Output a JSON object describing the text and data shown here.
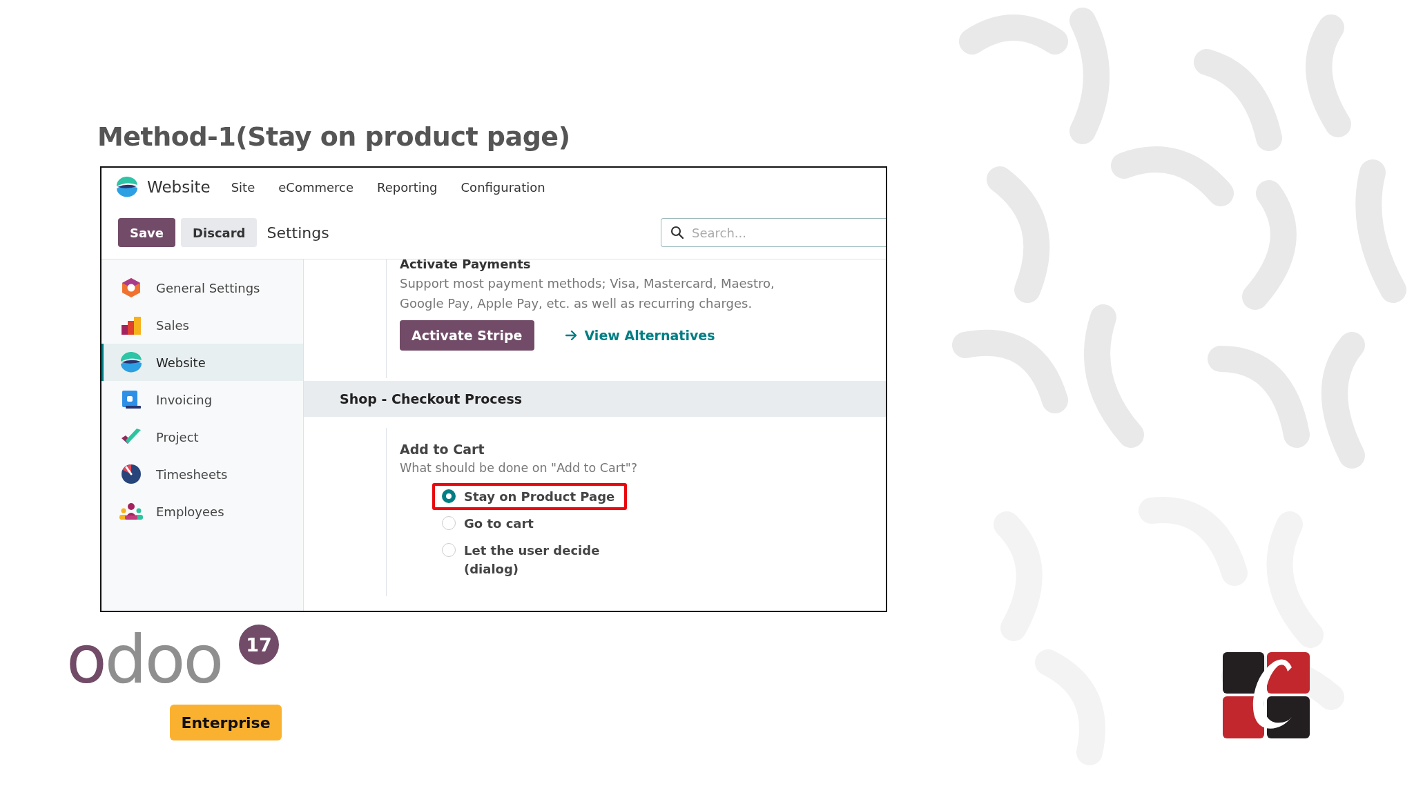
{
  "slide": {
    "title": "Method-1(Stay on product page)"
  },
  "app": {
    "nav": {
      "app_name": "Website",
      "menu": [
        "Site",
        "eCommerce",
        "Reporting",
        "Configuration"
      ]
    },
    "control_panel": {
      "buttons": [
        {
          "label": "Save",
          "kind": "primary"
        },
        {
          "label": "Discard",
          "kind": "secondary"
        }
      ],
      "breadcrumb": "Settings",
      "search": {
        "placeholder": "Search..."
      }
    },
    "sidebar": {
      "items": [
        {
          "label": "General Settings",
          "kind": "general",
          "selected": false
        },
        {
          "label": "Sales",
          "kind": "sales",
          "selected": false
        },
        {
          "label": "Website",
          "kind": "website",
          "selected": true
        },
        {
          "label": "Invoicing",
          "kind": "invoicing",
          "selected": false
        },
        {
          "label": "Project",
          "kind": "project",
          "selected": false
        },
        {
          "label": "Timesheets",
          "kind": "timesheets",
          "selected": false
        },
        {
          "label": "Employees",
          "kind": "employees",
          "selected": false
        }
      ]
    },
    "payments": {
      "heading": "Activate Payments",
      "description": "Support most payment methods; Visa, Mastercard, Maestro, Google Pay, Apple Pay, etc. as well as recurring charges.",
      "button": "Activate Stripe",
      "link": "View Alternatives"
    },
    "section": {
      "title": "Shop - Checkout Process",
      "setting": {
        "label": "Add to Cart",
        "help": "What should be done on \"Add to Cart\"?",
        "options": [
          {
            "label": "Stay on Product Page",
            "selected": true,
            "highlighted": true
          },
          {
            "label": "Go to cart",
            "selected": false,
            "highlighted": false
          },
          {
            "label": "Let the user decide (dialog)",
            "selected": false,
            "highlighted": false
          }
        ]
      }
    }
  },
  "branding": {
    "logo_text": "odoo",
    "version": "17",
    "edition": "Enterprise"
  }
}
